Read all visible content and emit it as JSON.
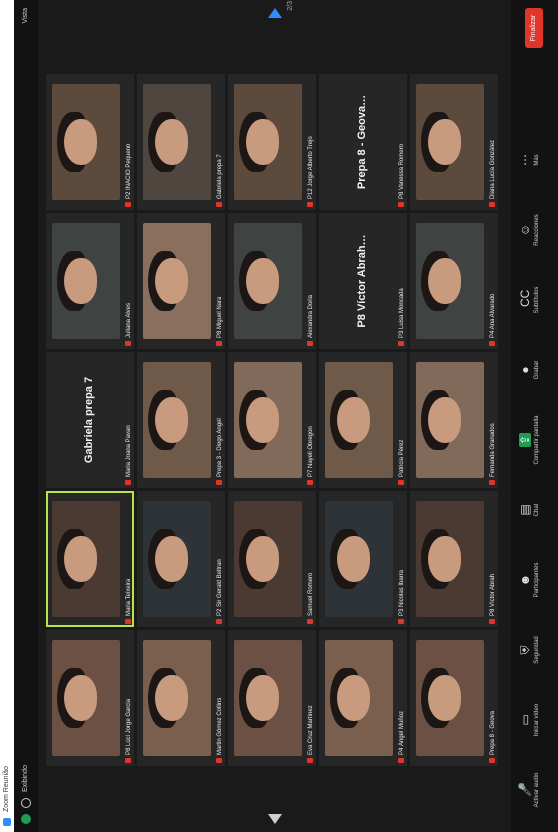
{
  "window": {
    "title": "Zoom Reunião"
  },
  "topbar": {
    "left": "Exibindo",
    "right": "Vista"
  },
  "gallery": {
    "page_indicator": "2/3",
    "tiles": [
      [
        "P8 Lúci Jorge Garcia",
        "Maria Teixeira",
        "Maria Joana Pavan",
        "Juliana Alves",
        "P2 INACIO Pequeno"
      ],
      [
        "Martin Gómez Collins",
        "P2 Sir Gerald Beltran",
        "Prepa 3 - Diego Angel",
        "P8 Miguel Nara",
        "Gabriela prepa 7"
      ],
      [
        "Eva Cruz Martínez",
        "Samuel Romero",
        "P7 Nayeli Obregon",
        "Alexandra Doria",
        "P12 Jorge Alberto Trejo"
      ],
      [
        "P4 Ángel Muñoz",
        "P3 Nicolas Ibarra",
        "Patricia Pérez",
        "P3 Luisa Moncada",
        "P8 Vanessa Romero"
      ],
      [
        "Prepa 8 - Geova",
        "P8 Víctor Abrah",
        "Fernanda Granados",
        "P4 Ana Alvarado",
        "Diana Lucía González"
      ]
    ],
    "text_tiles": {
      "3": "Gabriela prepa 7",
      "19": "P8 Víctor Abrah…",
      "20": "Prepa 8 - Geova…"
    }
  },
  "controls": {
    "items": [
      {
        "label": "Activar audio",
        "icon": "mic-icon"
      },
      {
        "label": "Iniciar vídeo",
        "icon": "video-icon"
      },
      {
        "label": "Seguridad",
        "icon": "shield-icon"
      },
      {
        "label": "Participantes",
        "icon": "people-icon"
      },
      {
        "label": "Chat",
        "icon": "chat-icon"
      },
      {
        "label": "Compartir pantalla",
        "icon": "share-icon"
      },
      {
        "label": "Grabar",
        "icon": "record-icon"
      },
      {
        "label": "Subtítulos",
        "icon": "cc-icon"
      },
      {
        "label": "Reacciones",
        "icon": "reaction-icon"
      },
      {
        "label": "Más",
        "icon": "more-icon"
      }
    ],
    "end_label": "Finalizar"
  }
}
